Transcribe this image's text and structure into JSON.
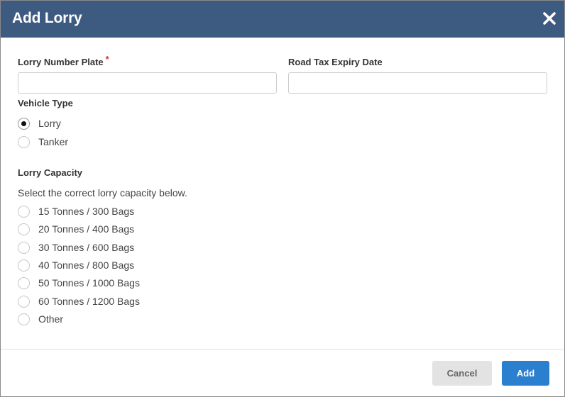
{
  "dialog": {
    "title": "Add Lorry",
    "close_icon": "close-icon"
  },
  "form": {
    "number_plate": {
      "label": "Lorry Number Plate",
      "required_mark": "*",
      "value": "",
      "placeholder": ""
    },
    "road_tax": {
      "label": "Road Tax Expiry Date",
      "value": "",
      "placeholder": ""
    },
    "vehicle_type": {
      "label": "Vehicle Type",
      "options": [
        {
          "label": "Lorry",
          "selected": true
        },
        {
          "label": "Tanker",
          "selected": false
        }
      ]
    },
    "capacity": {
      "label": "Lorry Capacity",
      "help": "Select the correct lorry capacity below.",
      "options": [
        {
          "label": "15 Tonnes / 300 Bags",
          "selected": false
        },
        {
          "label": "20 Tonnes / 400 Bags",
          "selected": false
        },
        {
          "label": "30 Tonnes / 600 Bags",
          "selected": false
        },
        {
          "label": "40 Tonnes / 800 Bags",
          "selected": false
        },
        {
          "label": "50 Tonnes / 1000 Bags",
          "selected": false
        },
        {
          "label": "60 Tonnes / 1200 Bags",
          "selected": false
        },
        {
          "label": "Other",
          "selected": false
        }
      ]
    }
  },
  "footer": {
    "cancel_label": "Cancel",
    "add_label": "Add"
  },
  "colors": {
    "header_bg": "#3d5a80",
    "primary_button": "#2a7fcf",
    "required": "#d9342b"
  }
}
